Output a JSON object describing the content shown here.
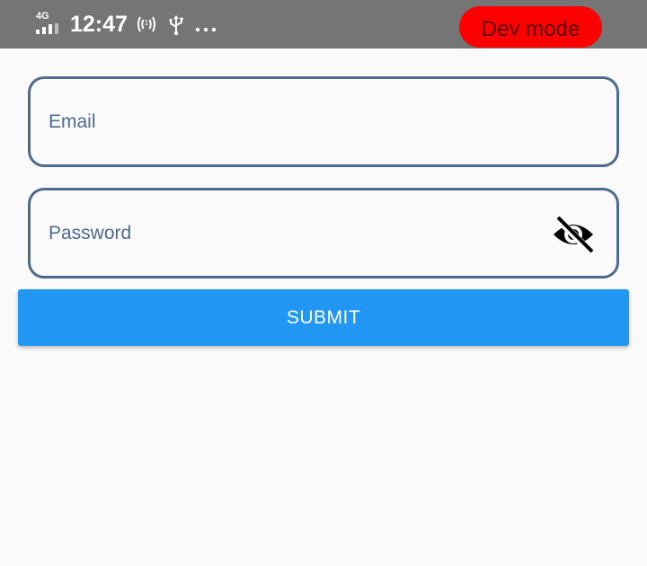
{
  "status_bar": {
    "network": "4G",
    "time": "12:47",
    "icons": [
      "hotspot-icon",
      "usb-icon",
      "more-icon"
    ],
    "background": "#757575"
  },
  "dev_badge": {
    "label": "Dev mode",
    "color": "#ff0000"
  },
  "form": {
    "email_placeholder": "Email",
    "password_placeholder": "Password",
    "password_toggle_icon": "eye-off-icon",
    "submit_label": "SUBMIT",
    "accent": "#2196f3",
    "border_color": "#4e6a8c"
  }
}
